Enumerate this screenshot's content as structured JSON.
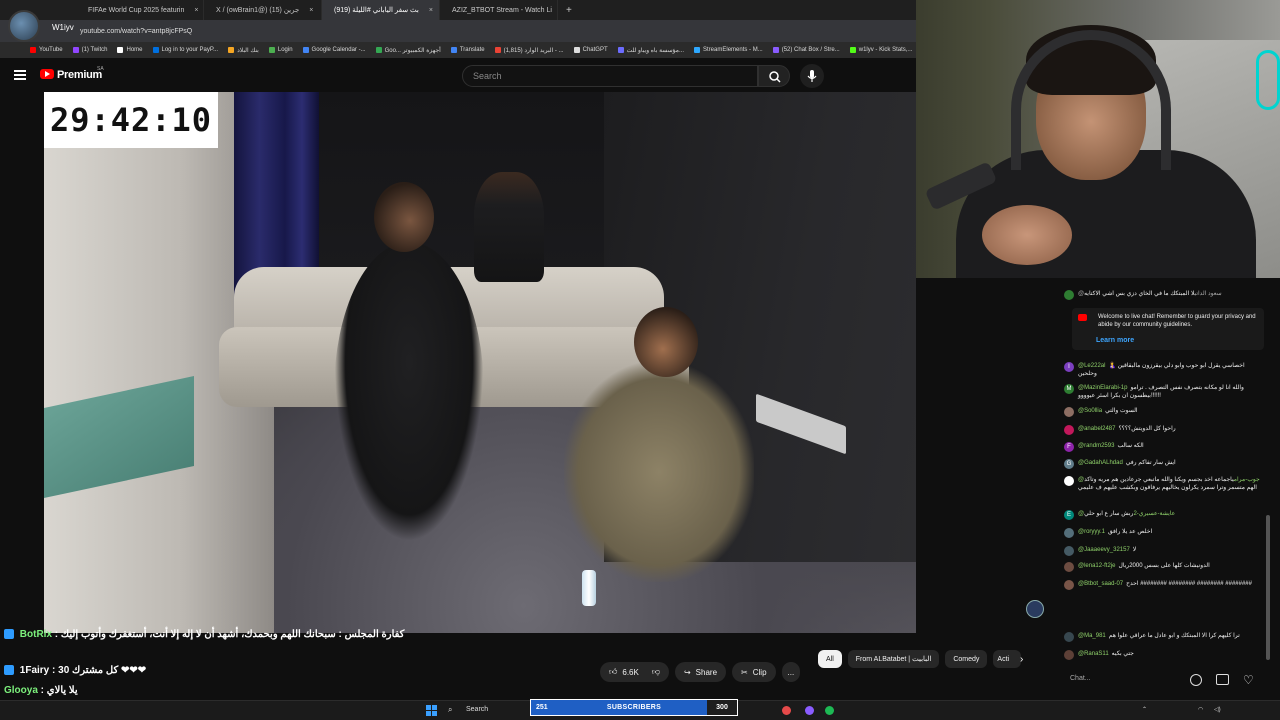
{
  "browser": {
    "tabs": [
      {
        "label": "FIFAe World Cup 2025 featurin",
        "color": "#2b6fd6"
      },
      {
        "label": "X / (owBrain1@) جرين (15)",
        "color": "#000000"
      },
      {
        "label": "(919) بث سفر الياباني #الليلة",
        "color": "#ff0000",
        "active": true
      },
      {
        "label": "AZIZ_BTBOT Stream - Watch Li",
        "color": "#53fc18"
      }
    ],
    "new_tab": "+",
    "profile_name": "W1iyv",
    "url": "youtube.com/watch?v=antp8jcFPsQ",
    "bookmarks": [
      {
        "label": "YouTube",
        "color": "#ff0000"
      },
      {
        "label": "(1) Twitch",
        "color": "#9146ff"
      },
      {
        "label": "Home",
        "color": "#ffffff"
      },
      {
        "label": "Log in to your PayP...",
        "color": "#0070e0"
      },
      {
        "label": "بنك البلاد",
        "color": "#f5a623"
      },
      {
        "label": "Login",
        "color": "#4caf50"
      },
      {
        "label": "Google Calendar -...",
        "color": "#4285f4"
      },
      {
        "label": "Goo... أجهزة الكمبيوتر",
        "color": "#34a853"
      },
      {
        "label": "Translate",
        "color": "#4285f4"
      },
      {
        "label": "(1,815) البريد الوارد - ...",
        "color": "#ea4335"
      },
      {
        "label": "ChatGPT",
        "color": "#dddddd"
      },
      {
        "label": "مؤسسة باه ويباو للت...",
        "color": "#6c6cff"
      },
      {
        "label": "StreamElements - M...",
        "color": "#2ea8ff"
      },
      {
        "label": "(52) Chat Box / Stre...",
        "color": "#8a5cff"
      },
      {
        "label": "w1lyv - Kick Stats,...",
        "color": "#53fc18"
      }
    ]
  },
  "youtube": {
    "brand": "Premium",
    "region": "SA",
    "search_placeholder": "Search",
    "timer": "29:42:10",
    "likes": "6.6K",
    "share": "Share",
    "clip": "Clip",
    "more": "...",
    "chips": [
      "All",
      "From ALBatabet | البابيت",
      "Comedy",
      "Acti"
    ]
  },
  "live_chat": {
    "top_message": {
      "author": "@سعود الداتي",
      "text": "لا المبتكك ما في الخاي دزي بس اشي الاكتايه"
    },
    "welcome": "Welcome to live chat! Remember to guard your privacy and abide by our community guidelines.",
    "learn_more": "Learn more",
    "messages": [
      {
        "initial": "I",
        "color": "#7b3fbf",
        "author": "@Le222al",
        "text": "اخصاسي يقرل ابو حوب وابو دلي بيقرزون مالبقاقين 🤱 وحلحين"
      },
      {
        "initial": "M",
        "color": "#2e7d32",
        "author": "@MazinElarabi-1p",
        "text": "والله انا لو مكانه بتصرف نفس التصرف . ترامو بيطسون ان بكرا اسئر عيوووو!!!!!!"
      },
      {
        "initial": "",
        "color": "#8d6e63",
        "author": "@So0llia",
        "text": "السوت والتي"
      },
      {
        "initial": "",
        "color": "#c2185b",
        "author": "@anabel2487",
        "text": "راحوا كل الدويتش؟؟؟؟"
      },
      {
        "initial": "F",
        "color": "#8e24aa",
        "author": "@randm2593",
        "text": "الكه سالب"
      },
      {
        "initial": "G",
        "color": "#607d8b",
        "author": "@GadahALhdad",
        "text": "ايش سار تفاكم رفي"
      },
      {
        "initial": "",
        "color": "#ffffff",
        "author": "@جوب-مرام",
        "text": "ياجماعه اخد بجسم ويكنا والله ماتبعي جرعادين هم مريه وتاكد الهم متسمر وترا سمرد يكرلون يخاليهم يرفاقون وبكشب عليهم ف عليمي"
      },
      {
        "initial": "E",
        "color": "#00897b",
        "author": "@عايشة-عسيري-2",
        "text": "ربش سار ع ابو حلي"
      },
      {
        "initial": "",
        "color": "#546e7a",
        "author": "@roryyy.1",
        "text": "اخلص عد يلا رافق"
      },
      {
        "initial": "",
        "color": "#455a64",
        "author": "@Jaaaeevy_32157",
        "text": "لا"
      },
      {
        "initial": "",
        "color": "#6d4c41",
        "author": "@lena12-ft2je",
        "text": "الدونيشات كلها على بسس 2000ريال"
      },
      {
        "initial": "",
        "color": "#795548",
        "author": "@Btbot_saad-07",
        "text": "احدح ######## ######## ######## ########"
      },
      {
        "initial": "",
        "color": "#37474f",
        "author": "@Ma_981",
        "text": "ترا كليهم كرا الا المبتكك و ابو عادل ما عراقي علوا هم"
      },
      {
        "initial": "",
        "color": "#5d4037",
        "author": "@RanaS11",
        "text": "جتي بكيه"
      }
    ],
    "input_placeholder": "Chat..."
  },
  "overlay_chat": [
    {
      "name": "BotRix",
      "text": "كفارة المجلس : سبحانك اللهم وبحمدك، أشهد أن لا إله إلا أنت، أستغفرك وأتوب إليك"
    },
    {
      "name": "1Fairy",
      "text": "كل مشترك 30 ❤❤❤"
    },
    {
      "name": "Glooya",
      "text": "يلا يالاي"
    }
  ],
  "taskbar": {
    "search": "Search",
    "subs_current": "251",
    "subs_label": "SUBSCRIBERS",
    "subs_goal": "300"
  }
}
